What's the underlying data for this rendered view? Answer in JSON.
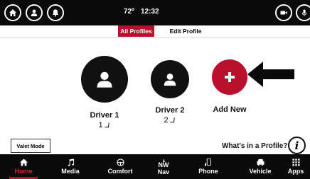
{
  "status_bar": {
    "temperature": "72º",
    "time": "12:32"
  },
  "profile_tabs": {
    "all_profiles": "All Profiles",
    "edit_profile": "Edit Profile",
    "active": "All Profiles"
  },
  "profiles": [
    {
      "name": "Driver 1",
      "seat": "1"
    },
    {
      "name": "Driver 2",
      "seat": "2"
    }
  ],
  "add_new_label": "Add New",
  "valet_mode_label": "Valet Mode",
  "whats_in_profile_label": "What's in a Profile?",
  "info_icon_glyph": "i",
  "bottom_nav": {
    "items": [
      {
        "label": "Home",
        "icon": "home-icon"
      },
      {
        "label": "Media",
        "icon": "music-note-icon"
      },
      {
        "label": "Comfort",
        "icon": "steering-wheel-icon"
      },
      {
        "label": "Nav",
        "icon": "compass-icon",
        "sub": "NW"
      },
      {
        "label": "Phone",
        "icon": "phone-icon"
      },
      {
        "label": "Vehicle",
        "icon": "car-icon"
      },
      {
        "label": "Apps",
        "icon": "grid-icon"
      }
    ],
    "active": "Home"
  },
  "colors": {
    "accent": "#b8102d",
    "bar_background": "#0a0a0a",
    "active_nav_label": "#e01b3b"
  }
}
